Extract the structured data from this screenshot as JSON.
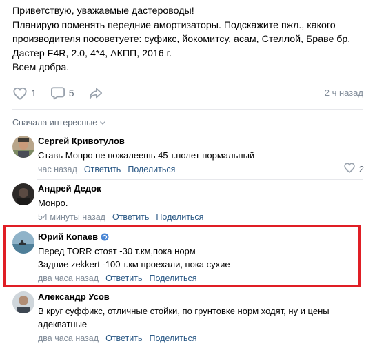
{
  "post": {
    "lines": [
      "Приветствую, уважаемые дастероводы!",
      "Планирую поменять передние амортизаторы. Подскажите пжл., какого",
      "производителя посоветуете: суфикс, йокомитсу, асам, Стеллой, Браве бр.",
      "Дастер F4R, 2.0, 4*4, АКПП, 2016 г.",
      "Всем добра."
    ],
    "likes": "1",
    "comments": "5",
    "time": "2 ч назад"
  },
  "sort_label": "Сначала интересные",
  "comments": [
    {
      "author": "Сергей Кривотулов",
      "text": "Ставь Монро не пожалеешь 45 т.полет нормальный",
      "time": "час назад",
      "reply": "Ответить",
      "share": "Поделиться",
      "likes": "2"
    },
    {
      "author": "Андрей Дедок",
      "text": "Монро.",
      "time": "54 минуты назад",
      "reply": "Ответить",
      "share": "Поделиться"
    },
    {
      "author": "Юрий Копаев",
      "text_lines": [
        "Перед TORR стоят -30 т.км,пока норм",
        "Задние zekkert -100 т.км проехали, пока сухие"
      ],
      "time": "два часа назад",
      "reply": "Ответить",
      "share": "Поделиться"
    },
    {
      "author": "Александр Усов",
      "text_lines": [
        "В круг суффикс, отличные стойки, по грунтовке норм ходят, ну и цены",
        "адекватные"
      ],
      "time": "два часа назад",
      "reply": "Ответить",
      "share": "Поделиться"
    }
  ],
  "colors": {
    "link": "#2a5885",
    "muted": "#818c99",
    "highlight": "#e01e25"
  }
}
